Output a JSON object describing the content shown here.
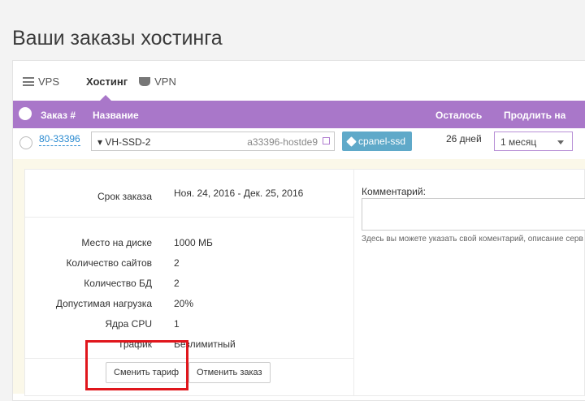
{
  "page": {
    "title": "Ваши заказы хостинга"
  },
  "tabs": [
    {
      "label": "VPS",
      "icon": "server-icon"
    },
    {
      "label": "Хостинг",
      "icon": "grid-icon",
      "active": true
    },
    {
      "label": "VPN",
      "icon": "shield-icon"
    }
  ],
  "table": {
    "headers": {
      "order": "Заказ #",
      "name": "Название",
      "remaining": "Осталось",
      "extend": "Продлить на"
    },
    "row": {
      "order_id": "80-33396",
      "plan": "▾ VH-SSD-2",
      "account": "a33396-hostde9",
      "tag": "cpanel-ssd",
      "remaining": "26 дней",
      "extend_selected": "1 месяц"
    }
  },
  "details": {
    "term_label": "Срок заказа",
    "term_value": "Ноя. 24, 2016 - Дек. 25, 2016",
    "specs": [
      {
        "label": "Место на диске",
        "value": "1000 МБ"
      },
      {
        "label": "Количество сайтов",
        "value": "2"
      },
      {
        "label": "Количество БД",
        "value": "2"
      },
      {
        "label": "Допустимая нагрузка",
        "value": "20%"
      },
      {
        "label": "Ядра CPU",
        "value": "1"
      },
      {
        "label": "Трафик",
        "value": "Безлимитный"
      }
    ],
    "comment_label": "Комментарий:",
    "comment_hint": "Здесь вы можете указать свой коментарий, описание серв заметки",
    "buttons": {
      "change_plan": "Сменить тариф",
      "cancel_order": "Отменить заказ"
    }
  },
  "colors": {
    "accent": "#a977c9",
    "link": "#2c8bd1",
    "tag": "#5fa9c9",
    "highlight": "#e0161c"
  }
}
